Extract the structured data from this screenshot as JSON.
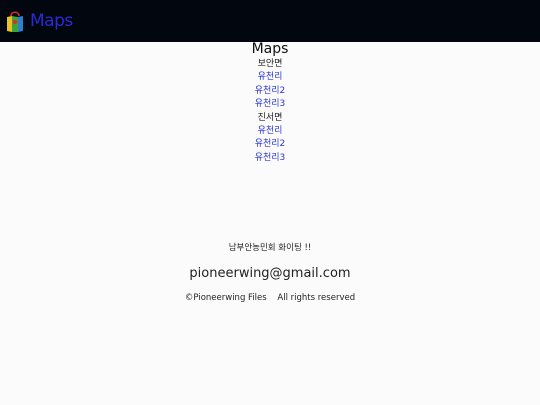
{
  "header": {
    "brand_label": "Maps",
    "brand_icon": "map-icon",
    "colors": {
      "bar": "#02060f",
      "brand": "#2a2ad8"
    }
  },
  "main": {
    "title": "Maps",
    "groups": [
      {
        "label": "보안면",
        "links": [
          "유천리",
          "유천리2",
          "유천리3"
        ]
      },
      {
        "label": "진서면",
        "links": [
          "유천리",
          "유천리2",
          "유천리3"
        ]
      }
    ]
  },
  "footer": {
    "slogan": "남부안농민회 화이팅 !!",
    "email": "pioneerwing@gmail.com",
    "copyright": "©Pioneerwing Files",
    "rights": "All rights reserved"
  }
}
